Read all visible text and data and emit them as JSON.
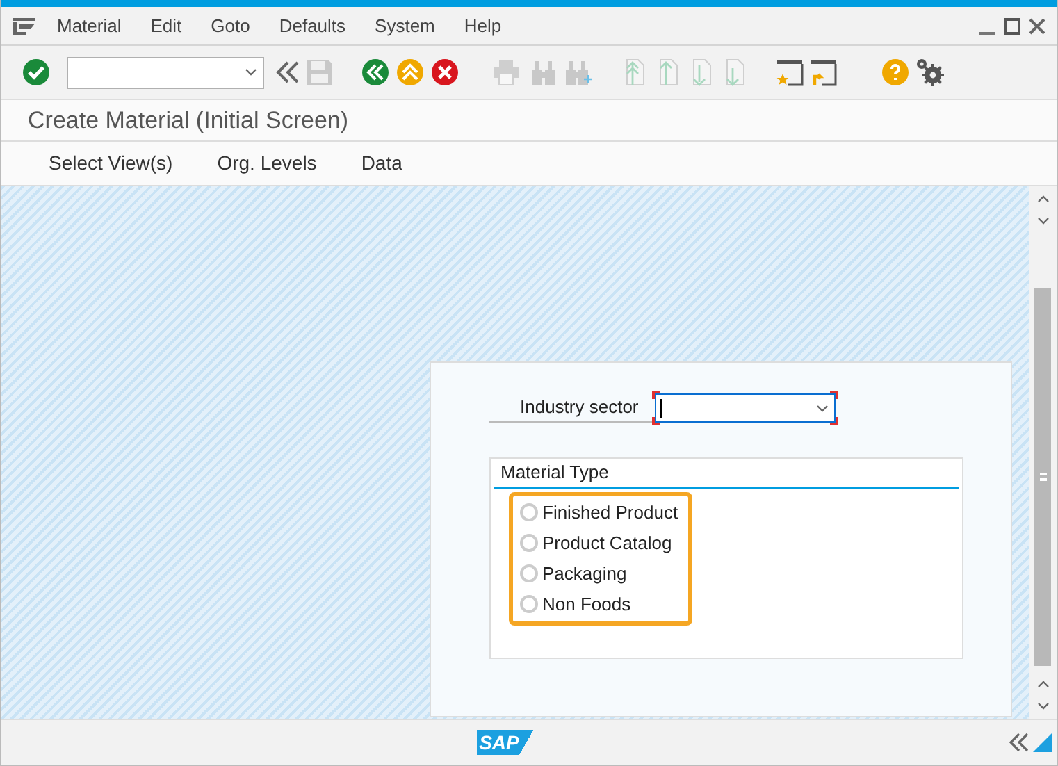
{
  "menu_bar": {
    "items": [
      "Material",
      "Edit",
      "Goto",
      "Defaults",
      "System",
      "Help"
    ]
  },
  "toolbar": [
    {
      "kind": "enter",
      "disabled": false
    },
    {
      "kind": "command-field",
      "disabled": false
    },
    {
      "kind": "back-chevrons",
      "disabled": false
    },
    {
      "kind": "save",
      "disabled": true
    },
    {
      "kind": "back",
      "disabled": false
    },
    {
      "kind": "exit",
      "disabled": false
    },
    {
      "kind": "cancel",
      "disabled": false
    },
    {
      "kind": "print",
      "disabled": true
    },
    {
      "kind": "find",
      "disabled": true
    },
    {
      "kind": "find-next",
      "disabled": true
    },
    {
      "kind": "first-page",
      "disabled": true
    },
    {
      "kind": "previous-page",
      "disabled": true
    },
    {
      "kind": "next-page",
      "disabled": true
    },
    {
      "kind": "last-page",
      "disabled": true
    },
    {
      "kind": "new-session",
      "disabled": false
    },
    {
      "kind": "shortcut",
      "disabled": false
    },
    {
      "kind": "help",
      "disabled": false
    },
    {
      "kind": "settings",
      "disabled": false
    }
  ],
  "title": "Create Material (Initial Screen)",
  "app_toolbar": [
    "Select View(s)",
    "Org. Levels",
    "Data"
  ],
  "form": {
    "industry_sector": {
      "label": "Industry sector",
      "required": true
    },
    "material_type": {
      "title": "Material Type",
      "highlighted": true,
      "options": [
        {
          "label": "Finished Product",
          "selected": false
        },
        {
          "label": "Product Catalog",
          "selected": false
        },
        {
          "label": "Packaging",
          "selected": false
        },
        {
          "label": "Non Foods",
          "selected": false
        }
      ]
    }
  },
  "footer": {
    "logo": "SAP"
  }
}
